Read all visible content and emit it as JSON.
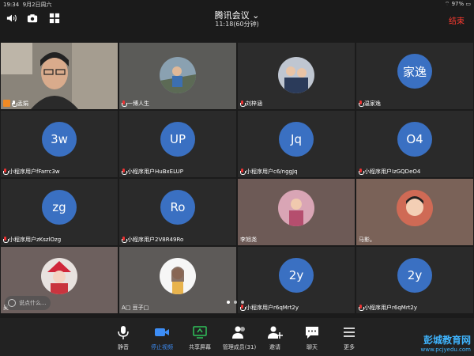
{
  "status_bar": {
    "time": "19:34",
    "date": "9月2日周六",
    "battery": "97%"
  },
  "header": {
    "title": "腾讯会议",
    "time": "11:18(60分钟)",
    "end_label": "结束"
  },
  "tiles": [
    {
      "type": "photo",
      "name": "孟娟",
      "host": true
    },
    {
      "type": "avatar",
      "name": "一博人生"
    },
    {
      "type": "avatar",
      "name": "刘梓涵"
    },
    {
      "type": "initials",
      "initials": "家逸",
      "name": "温家逸"
    },
    {
      "type": "initials",
      "initials": "3w",
      "name": "小程序用户fFarrc3w"
    },
    {
      "type": "initials",
      "initials": "UP",
      "name": "小程序用户HuBxELUP"
    },
    {
      "type": "initials",
      "initials": "Jq",
      "name": "小程序用户c6/nggJq"
    },
    {
      "type": "initials",
      "initials": "O4",
      "name": "小程序用户IzGQDeO4"
    },
    {
      "type": "initials",
      "initials": "zg",
      "name": "小程序用户zKszlOzg"
    },
    {
      "type": "initials",
      "initials": "Ro",
      "name": "小程序用户2V8R49Ro"
    },
    {
      "type": "avatar",
      "name": "李旭尧"
    },
    {
      "type": "avatar",
      "name": "马影。"
    },
    {
      "type": "avatar",
      "name": "吴"
    },
    {
      "type": "avatar",
      "name": "A□ 豆子□"
    },
    {
      "type": "initials",
      "initials": "2y",
      "name": "小程序用户r6qMrt2y"
    },
    {
      "type": "initials",
      "initials": "2y",
      "name": "小程序用户r6qMrt2y"
    }
  ],
  "comment_placeholder": "说点什么...",
  "toolbar": {
    "mute": "静音",
    "stop_video": "停止视频",
    "share": "共享屏幕",
    "members": "管理成员(31)",
    "invite": "邀请",
    "chat": "聊天",
    "more": "更多"
  },
  "watermark": {
    "line1": "彭城教育网",
    "line2": "www.pcjyedu.com"
  }
}
